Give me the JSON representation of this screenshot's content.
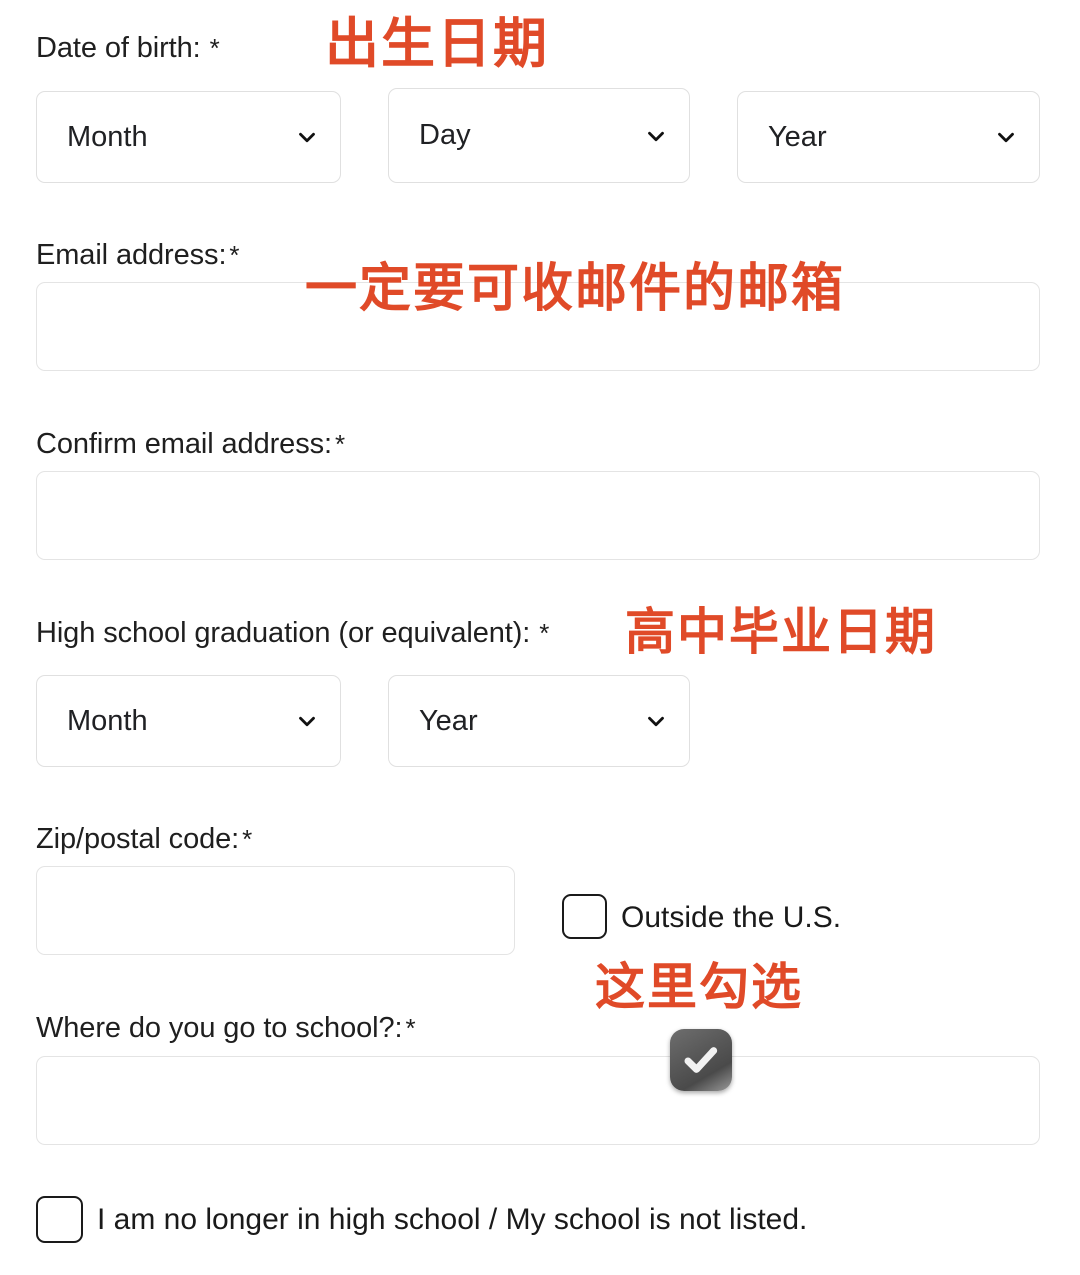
{
  "form": {
    "fields": [
      {
        "id": "date-of-birth",
        "label": "Date of birth:",
        "required_marker": "*",
        "selects": [
          {
            "name": "month",
            "value": "Month"
          },
          {
            "name": "day",
            "value": "Day"
          },
          {
            "name": "year",
            "value": "Year"
          }
        ]
      },
      {
        "id": "email-address",
        "label": "Email address:",
        "required_marker": "*",
        "value": "",
        "placeholder": ""
      },
      {
        "id": "confirm-email-address",
        "label": "Confirm email address:",
        "required_marker": "*",
        "value": "",
        "placeholder": ""
      },
      {
        "id": "high-school-graduation",
        "label": "High school graduation (or equivalent):",
        "required_marker": "*",
        "selects": [
          {
            "name": "month",
            "value": "Month"
          },
          {
            "name": "year",
            "value": "Year"
          }
        ]
      },
      {
        "id": "zip-postal-code",
        "label": "Zip/postal code:",
        "required_marker": "*",
        "value": "",
        "placeholder": ""
      },
      {
        "id": "where-do-you-go-to-school",
        "label": "Where do you go to school?:",
        "required_marker": "*",
        "value": "",
        "placeholder": ""
      }
    ],
    "checkboxes": [
      {
        "id": "outside-the-us",
        "label": "Outside the U.S.",
        "checked": false
      },
      {
        "id": "no-longer-in-high-school",
        "label": "I am no longer in high school / My school is not listed.",
        "checked": false
      }
    ]
  },
  "annotations": [
    {
      "id": "dob-note",
      "text": "出生日期"
    },
    {
      "id": "email-note",
      "text": "一定要可收邮件的邮箱"
    },
    {
      "id": "hs-grad-note",
      "text": "高中毕业日期"
    },
    {
      "id": "check-here-note",
      "text": "这里勾选"
    }
  ],
  "colors": {
    "annotation_red": "#E04A28",
    "input_border": "#e4e4e4",
    "checkbox_border": "#1a1a1a",
    "text": "#1f1f1f",
    "background": "#ffffff",
    "cursor_gray": "#585858"
  },
  "cursor": {
    "id": "checkmark-cursor",
    "icon": "checkmark-icon"
  }
}
